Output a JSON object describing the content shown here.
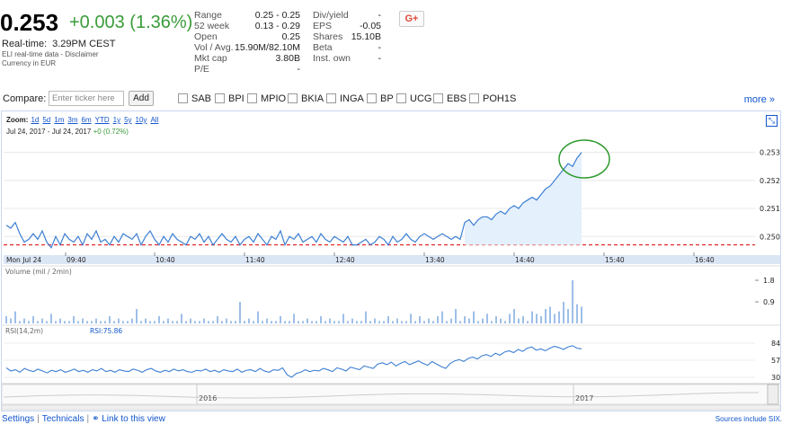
{
  "quote": {
    "price": "0.253",
    "change": "+0.003 (1.36%)",
    "realtime_label": "Real-time:",
    "realtime_time": "3.29PM CEST",
    "data_source": "ELI real-time data - Disclaimer",
    "currency": "Currency in EUR"
  },
  "stats_left": [
    {
      "label": "Range",
      "value": "0.25 - 0.25"
    },
    {
      "label": "52 week",
      "value": "0.13 - 0.29"
    },
    {
      "label": "Open",
      "value": "0.25"
    },
    {
      "label": "Vol / Avg.",
      "value": "15.90M/82.10M"
    },
    {
      "label": "Mkt cap",
      "value": "3.80B"
    },
    {
      "label": "P/E",
      "value": "-"
    }
  ],
  "stats_right": [
    {
      "label": "Div/yield",
      "value": "-"
    },
    {
      "label": "EPS",
      "value": "-0.05"
    },
    {
      "label": "Shares",
      "value": "15.10B"
    },
    {
      "label": "Beta",
      "value": "-"
    },
    {
      "label": "Inst. own",
      "value": "-"
    }
  ],
  "share_button": "G+",
  "compare": {
    "label": "Compare:",
    "placeholder": "Enter ticker here",
    "add_label": "Add",
    "tickers": [
      "SAB",
      "BPI",
      "MPIO",
      "BKIA",
      "INGA",
      "BP",
      "UCG",
      "EBS",
      "POH1S"
    ],
    "more_label": "more »"
  },
  "chart": {
    "zoom_label": "Zoom:",
    "zoom_options": [
      "1d",
      "5d",
      "1m",
      "3m",
      "6m",
      "YTD",
      "1y",
      "5y",
      "10y",
      "All"
    ],
    "date_from": "Jul 24, 2017",
    "date_sep": "-",
    "date_to": "Jul 24, 2017",
    "date_change": "+0 (0.72%)",
    "expand_icon": "expand-icon",
    "volume_label": "Volume (mil / 2min)",
    "rsi_label": "RSI(14,2m)",
    "rsi_value": "RSI:75.86",
    "timeline_years": [
      "2016",
      "2017"
    ]
  },
  "chart_data": {
    "type": "line",
    "x_ticks": [
      "Mon Jul 24",
      "09:40",
      "10:40",
      "11:40",
      "12:40",
      "13:40",
      "14:40",
      "15:40",
      "16:40"
    ],
    "y_ticks": [
      "0.253",
      "0.252",
      "0.251",
      "0.250"
    ],
    "ylim": [
      0.2494,
      0.2535
    ],
    "price_series": [
      0.2504,
      0.2503,
      0.2505,
      0.2501,
      0.2498,
      0.2499,
      0.2501,
      0.2499,
      0.2502,
      0.2498,
      0.2496,
      0.25,
      0.2497,
      0.2501,
      0.2499,
      0.2498,
      0.25,
      0.2497,
      0.2501,
      0.2499,
      0.2502,
      0.2498,
      0.2499,
      0.2497,
      0.25,
      0.2498,
      0.2501,
      0.25,
      0.2499,
      0.2501,
      0.2497,
      0.25,
      0.2502,
      0.2499,
      0.2497,
      0.25,
      0.2498,
      0.2501,
      0.2499,
      0.2498,
      0.2497,
      0.25,
      0.2499,
      0.2501,
      0.2498,
      0.25,
      0.2497,
      0.2499,
      0.2501,
      0.2499,
      0.2498,
      0.25,
      0.2497,
      0.2499,
      0.25,
      0.2498,
      0.2501,
      0.2499,
      0.2497,
      0.25,
      0.2499,
      0.2502,
      0.2497,
      0.25,
      0.2499,
      0.2501,
      0.2498,
      0.2499,
      0.25,
      0.2498,
      0.2501,
      0.2499,
      0.2498,
      0.25,
      0.2499,
      0.2498,
      0.25,
      0.2497,
      0.2497,
      0.2498,
      0.2499,
      0.2497,
      0.2498,
      0.25,
      0.2499,
      0.2497,
      0.25,
      0.2498,
      0.2499,
      0.2501,
      0.2499,
      0.2498,
      0.25,
      0.2501,
      0.25,
      0.2499,
      0.25,
      0.2501,
      0.25,
      0.2499,
      0.25,
      0.2499,
      0.2505,
      0.2506,
      0.2504,
      0.2506,
      0.2507,
      0.2507,
      0.2506,
      0.2508,
      0.2509,
      0.2508,
      0.251,
      0.2511,
      0.251,
      0.2512,
      0.2513,
      0.2514,
      0.2513,
      0.2515,
      0.2517,
      0.2518,
      0.252,
      0.2522,
      0.2524,
      0.2526,
      0.2525,
      0.2528,
      0.253
    ],
    "volume_series": [
      0.3,
      0.2,
      0.5,
      0.1,
      0.2,
      0.1,
      0.3,
      0.1,
      0.2,
      0.1,
      0.4,
      0.1,
      0.2,
      0.1,
      0.1,
      0.3,
      0.1,
      0.2,
      0.1,
      0.1,
      0.2,
      0.1,
      0.1,
      0.3,
      0.1,
      0.2,
      0.1,
      0.1,
      0.2,
      0.6,
      0.1,
      0.2,
      0.1,
      0.1,
      0.3,
      0.1,
      0.2,
      0.1,
      0.1,
      0.4,
      0.1,
      0.2,
      0.1,
      0.1,
      0.2,
      0.1,
      0.1,
      0.3,
      0.1,
      0.2,
      0.1,
      0.1,
      0.9,
      0.1,
      0.2,
      0.1,
      0.5,
      0.1,
      0.2,
      0.1,
      0.1,
      0.3,
      0.1,
      0.1,
      0.4,
      0.1,
      0.1,
      0.2,
      0.1,
      0.1,
      0.3,
      0.1,
      0.2,
      0.1,
      0.1,
      0.4,
      0.1,
      0.2,
      0.1,
      0.1,
      0.5,
      0.1,
      0.2,
      0.1,
      0.1,
      0.3,
      0.1,
      0.2,
      0.1,
      0.1,
      0.4,
      0.1,
      0.3,
      0.1,
      0.2,
      0.1,
      0.3,
      0.5,
      0.1,
      0.2,
      0.6,
      0.1,
      0.3,
      0.2,
      0.5,
      0.1,
      0.2,
      0.4,
      0.1,
      0.3,
      0.2,
      0.1,
      0.4,
      0.6,
      0.2,
      0.3,
      0.1,
      0.5,
      0.4,
      0.3,
      0.6,
      0.7,
      0.4,
      0.5,
      0.9,
      0.6,
      1.8,
      0.8,
      0.5,
      0.7,
      0.4,
      0.3,
      0.2
    ],
    "volume_ticks": [
      "1.8",
      "0.9"
    ],
    "rsi_series": [
      45,
      40,
      42,
      38,
      44,
      41,
      39,
      43,
      40,
      37,
      41,
      39,
      42,
      38,
      40,
      43,
      39,
      41,
      38,
      42,
      40,
      44,
      39,
      41,
      38,
      42,
      40,
      39,
      43,
      41,
      38,
      42,
      44,
      40,
      38,
      41,
      39,
      43,
      40,
      42,
      39,
      38,
      41,
      40,
      43,
      39,
      41,
      38,
      42,
      40,
      39,
      43,
      38,
      41,
      42,
      39,
      44,
      40,
      38,
      42,
      41,
      45,
      34,
      30,
      36,
      38,
      42,
      39,
      41,
      40,
      44,
      42,
      39,
      45,
      43,
      40,
      46,
      44,
      42,
      48,
      46,
      44,
      51,
      53,
      50,
      54,
      48,
      52,
      55,
      50,
      53,
      56,
      52,
      49,
      55,
      51,
      47,
      44,
      52,
      56,
      58,
      55,
      60,
      62,
      59,
      64,
      66,
      63,
      68,
      65,
      70,
      72,
      69,
      74,
      71,
      76,
      78,
      73,
      75,
      72,
      76,
      79,
      77,
      74,
      78,
      80,
      76,
      75
    ],
    "rsi_ticks": [
      "84",
      "57",
      "30"
    ]
  }
}
